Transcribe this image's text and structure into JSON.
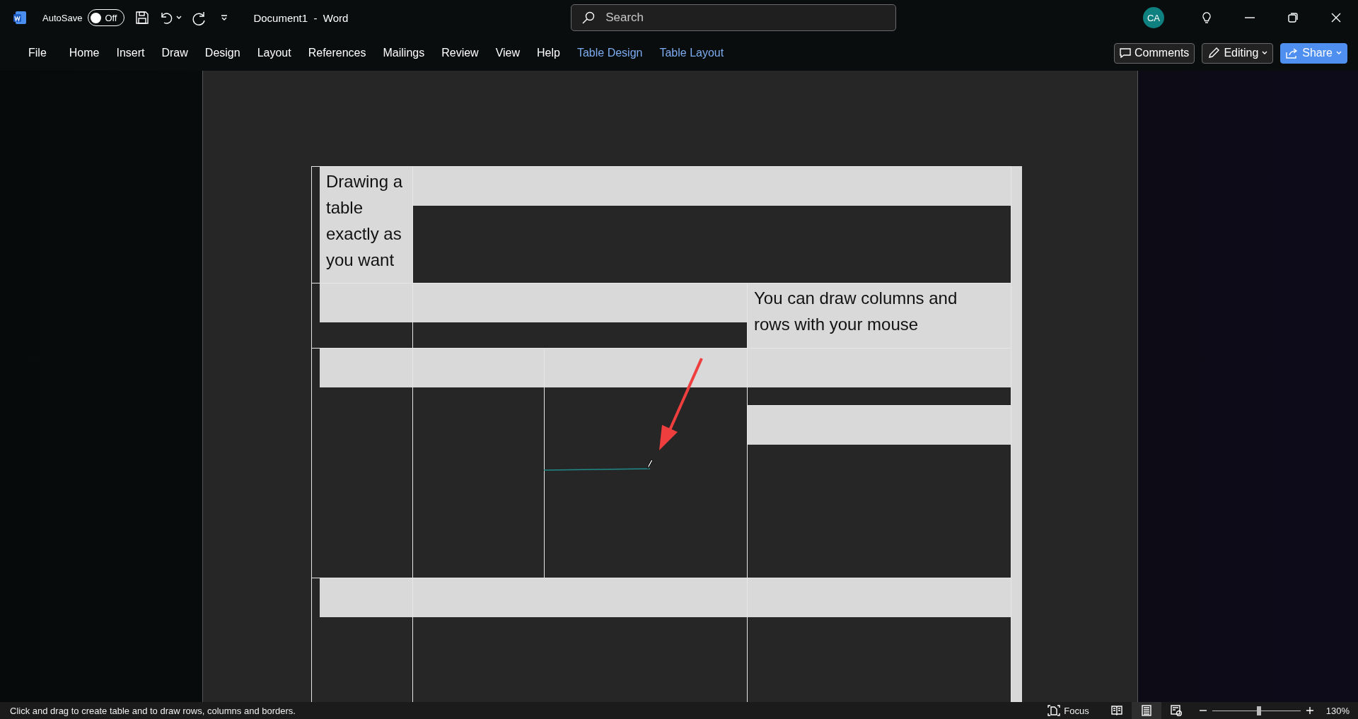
{
  "title_bar": {
    "autosave": {
      "label": "AutoSave",
      "on": false,
      "state_text": "Off"
    },
    "document_title": "Document1  -  Word",
    "search": {
      "placeholder": "Search"
    },
    "account": {
      "initials": "CA"
    }
  },
  "ribbon": {
    "tabs": [
      {
        "label": "File",
        "contextual": false,
        "selected": false
      },
      {
        "label": "Home",
        "contextual": false,
        "selected": false
      },
      {
        "label": "Insert",
        "contextual": false,
        "selected": false
      },
      {
        "label": "Draw",
        "contextual": false,
        "selected": false
      },
      {
        "label": "Design",
        "contextual": false,
        "selected": false
      },
      {
        "label": "Layout",
        "contextual": false,
        "selected": false
      },
      {
        "label": "References",
        "contextual": false,
        "selected": false
      },
      {
        "label": "Mailings",
        "contextual": false,
        "selected": false
      },
      {
        "label": "Review",
        "contextual": false,
        "selected": false
      },
      {
        "label": "View",
        "contextual": false,
        "selected": false
      },
      {
        "label": "Help",
        "contextual": false,
        "selected": false
      },
      {
        "label": "Table Design",
        "contextual": true,
        "selected": false
      },
      {
        "label": "Table Layout",
        "contextual": true,
        "selected": false
      }
    ],
    "comments": "Comments",
    "editing": "Editing",
    "share": "Share"
  },
  "table": {
    "rows": [
      {
        "cells": [
          {
            "kind": "filled",
            "text": "Drawing a table exactly as you want"
          },
          {
            "kind": "banded"
          }
        ]
      },
      {
        "cells": [
          {
            "kind": "banded"
          },
          {
            "kind": "banded"
          },
          {
            "kind": "filled",
            "text": "You can draw columns and rows with your mouse"
          }
        ]
      },
      {
        "cells": [
          {
            "kind": "banded"
          },
          {
            "kind": "banded"
          },
          {
            "kind": "banded",
            "drawing_line": true
          },
          {
            "kind": "split"
          }
        ]
      },
      {
        "cells": [
          {
            "kind": "banded"
          },
          {
            "kind": "banded"
          },
          {
            "kind": "banded"
          }
        ]
      }
    ]
  },
  "status_bar": {
    "message": "Click and drag to create table and to draw rows, columns and borders.",
    "focus": "Focus",
    "views": [
      {
        "kind": "read",
        "selected": false
      },
      {
        "kind": "print",
        "selected": true
      },
      {
        "kind": "web",
        "selected": false
      }
    ],
    "zoom": {
      "level": 0.53,
      "reading": "130%"
    }
  }
}
